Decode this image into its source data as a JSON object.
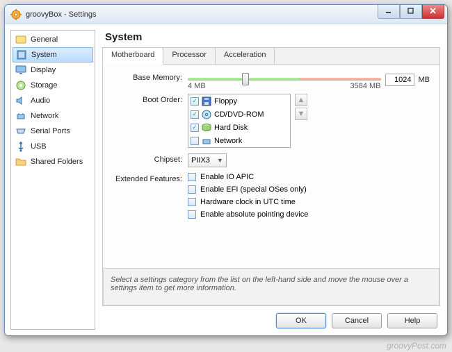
{
  "window": {
    "title": "groovyBox - Settings"
  },
  "sidebar": {
    "items": [
      {
        "label": "General"
      },
      {
        "label": "System"
      },
      {
        "label": "Display"
      },
      {
        "label": "Storage"
      },
      {
        "label": "Audio"
      },
      {
        "label": "Network"
      },
      {
        "label": "Serial Ports"
      },
      {
        "label": "USB"
      },
      {
        "label": "Shared Folders"
      }
    ]
  },
  "main": {
    "heading": "System",
    "tabs": [
      {
        "label": "Motherboard"
      },
      {
        "label": "Processor"
      },
      {
        "label": "Acceleration"
      }
    ],
    "base_memory": {
      "label": "Base Memory:",
      "value": "1024",
      "unit": "MB",
      "min_label": "4 MB",
      "max_label": "3584 MB",
      "min": 4,
      "max": 3584,
      "green_end_pct": 58,
      "red_start_pct": 58,
      "thumb_pct": 28
    },
    "boot_order": {
      "label": "Boot Order:",
      "items": [
        {
          "label": "Floppy",
          "checked": true
        },
        {
          "label": "CD/DVD-ROM",
          "checked": true
        },
        {
          "label": "Hard Disk",
          "checked": true
        },
        {
          "label": "Network",
          "checked": false
        }
      ]
    },
    "chipset": {
      "label": "Chipset:",
      "value": "PIIX3"
    },
    "extended": {
      "label": "Extended Features:",
      "items": [
        {
          "label": "Enable IO APIC",
          "checked": false
        },
        {
          "label": "Enable EFI (special OSes only)",
          "checked": false
        },
        {
          "label": "Hardware clock in UTC time",
          "checked": false
        },
        {
          "label": "Enable absolute pointing device",
          "checked": false
        }
      ]
    },
    "hint": "Select a settings category from the list on the left-hand side and move the mouse over a settings item to get more information."
  },
  "buttons": {
    "ok": "OK",
    "cancel": "Cancel",
    "help": "Help"
  },
  "watermark": "groovyPost.com"
}
